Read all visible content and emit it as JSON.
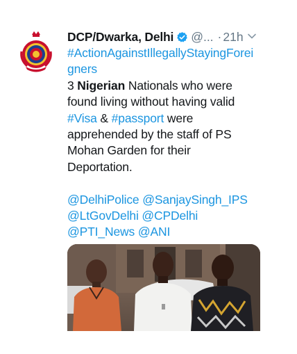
{
  "tweet": {
    "author": {
      "display_name": "DCP/Dwarka, Delhi",
      "handle": "@...",
      "verified": true,
      "avatar_icon": "delhi-police-emblem-icon"
    },
    "separator": "·",
    "timestamp": "21h",
    "menu_icon": "chevron-down-icon",
    "hashtag_line1": "#ActionAgainstIllegallyStayingForei",
    "hashtag_line2": "gners",
    "body": {
      "l1_pre": "3 ",
      "l1_bold": "Nigerian",
      "l1_post": " Nationals who were",
      "l2": "found living without having valid",
      "l3_tag1": "#Visa",
      "l3_mid": " & ",
      "l3_tag2": "#passport",
      "l3_post": " were",
      "l4": "apprehended by the staff of PS",
      "l5": "Mohan Garden for their",
      "l6": "Deportation."
    },
    "mentions": {
      "m1": "@DelhiPolice",
      "m2": "@SanjaySingh_IPS",
      "m3": "@LtGovDelhi",
      "m4": "@CPDelhi",
      "m5": "@PTI_News",
      "m6": "@ANI"
    },
    "media": {
      "type": "photo",
      "people_count": 3
    }
  },
  "colors": {
    "text": "#14171a",
    "secondary": "#657786",
    "link": "#1b95e0",
    "verified": "#1da1f2"
  }
}
